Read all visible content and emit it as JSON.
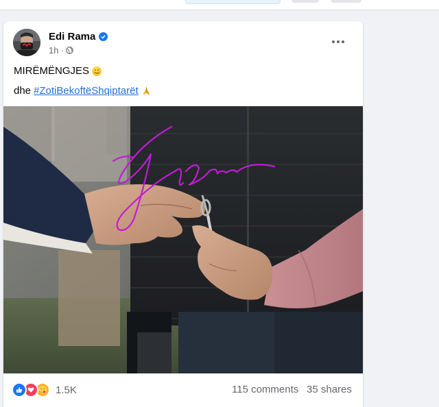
{
  "post": {
    "author": "Edi Rama",
    "time": "1h",
    "text_line1": "MIRËMËNGJES",
    "text_line2_prefix": "dhe",
    "hashtag": "#ZotiBekoftëShqiptarët",
    "signature_color": "#c21bd6"
  },
  "footer": {
    "reaction_count": "1.5K",
    "comments": "115 comments",
    "shares": "35 shares"
  },
  "icons": [
    "verified-icon",
    "globe-icon",
    "more-icon",
    "smile-emoji",
    "pray-emoji",
    "like-icon",
    "love-icon",
    "care-icon"
  ],
  "colors": {
    "link": "#216fdb",
    "secondary_text": "#65676b",
    "like_blue": "#1877f2",
    "love_red": "#f33e58"
  }
}
